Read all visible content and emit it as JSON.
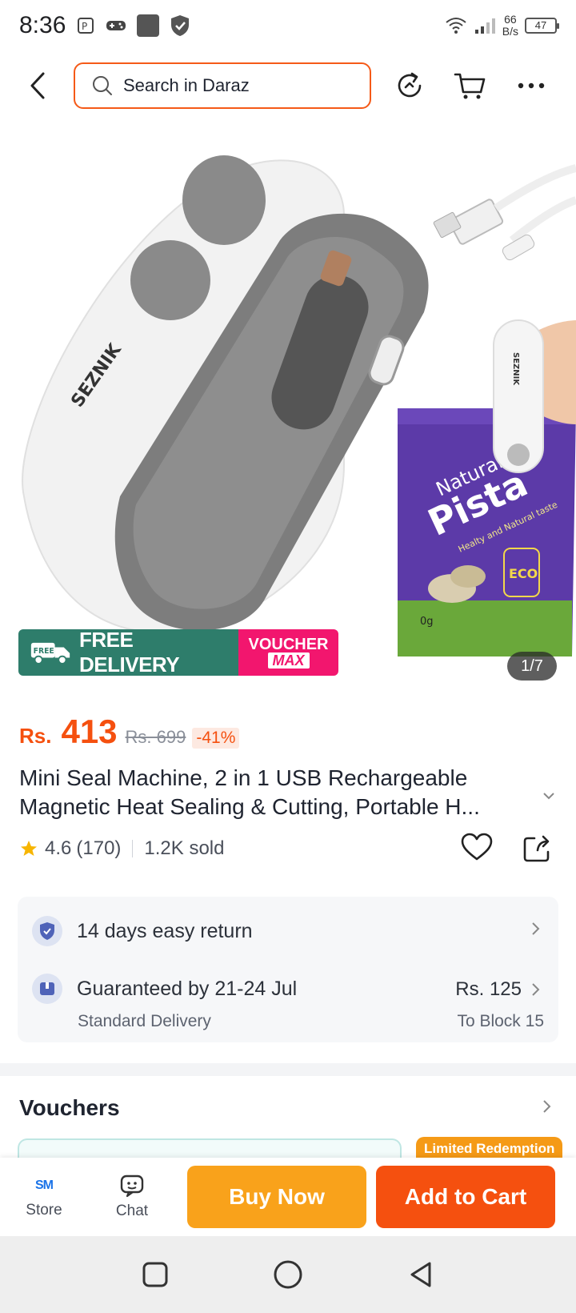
{
  "status_bar": {
    "time": "8:36",
    "network_speed_value": "66",
    "network_speed_unit": "B/s",
    "battery": "47"
  },
  "search": {
    "placeholder": "Search in Daraz"
  },
  "gallery": {
    "counter": "1/7",
    "badge_free_tag": "FREE",
    "badge_free_label": "FREE DELIVERY",
    "badge_voucher_line1": "VOUCHER",
    "badge_voucher_line2": "MAX",
    "brand_text": "SEZNIK",
    "bag_text_1": "Natural",
    "bag_text_2": "Pista",
    "bag_text_3": "Healty and Natural taste",
    "bag_text_4": "ECO",
    "bag_text_5": "0g"
  },
  "price": {
    "currency": "Rs.",
    "value": "413",
    "original": "Rs. 699",
    "discount": "-41%"
  },
  "product": {
    "title_line1": "Mini Seal Machine, 2 in 1 USB Rechargeable",
    "title_line2": "Magnetic Heat Sealing & Cutting, Portable H..."
  },
  "rating": {
    "score": "4.6",
    "count": "(170)",
    "sold": "1.2K sold"
  },
  "delivery": {
    "return_text": "14 days easy return",
    "guarantee_text": "Guaranteed by 21-24 Jul",
    "delivery_type": "Standard Delivery",
    "fee": "Rs. 125",
    "destination": "To Block 15"
  },
  "vouchers": {
    "heading": "Vouchers",
    "limited_tag": "Limited Redemption"
  },
  "action_bar": {
    "store_logo": "SM",
    "store_label": "Store",
    "chat_label": "Chat",
    "buy_now": "Buy Now",
    "add_to_cart": "Add to Cart"
  },
  "colors": {
    "accent_orange": "#f5500f",
    "buy_now_yellow": "#f9a21b",
    "free_delivery_green": "#2e7d6b",
    "voucher_pink": "#f2166e"
  }
}
